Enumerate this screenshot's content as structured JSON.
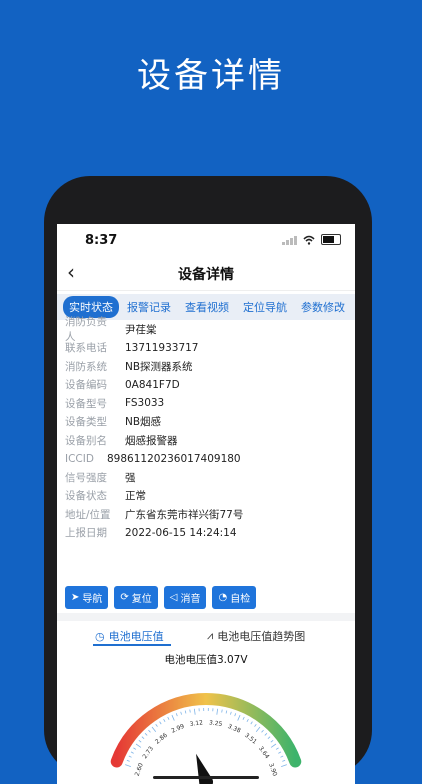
{
  "promo": {
    "title": "设备详情"
  },
  "status_bar": {
    "time": "8:37"
  },
  "nav": {
    "back": "‹",
    "title": "设备详情"
  },
  "tabs": [
    "实时状态",
    "报警记录",
    "查看视频",
    "定位导航",
    "参数修改"
  ],
  "info": [
    {
      "k": "消防负责人",
      "v": "尹荏棠"
    },
    {
      "k": "联系电话",
      "v": "13711933717"
    },
    {
      "k": "消防系统",
      "v": "NB探测器系统"
    },
    {
      "k": "设备编码",
      "v": "0A841F7D"
    },
    {
      "k": "设备型号",
      "v": "FS3033"
    },
    {
      "k": "设备类型",
      "v": "NB烟感"
    },
    {
      "k": "设备别名",
      "v": "烟感报警器"
    },
    {
      "k": "ICCID",
      "v": "89861120236017409180"
    },
    {
      "k": "信号强度",
      "v": "强"
    },
    {
      "k": "设备状态",
      "v": "正常"
    },
    {
      "k": "地址/位置",
      "v": "广东省东莞市祥兴街77号"
    },
    {
      "k": "上报日期",
      "v": "2022-06-15 14:24:14"
    }
  ],
  "actions": [
    {
      "label": "导航",
      "icon": "➤"
    },
    {
      "label": "复位",
      "icon": "⟳"
    },
    {
      "label": "消音",
      "icon": "◁"
    },
    {
      "label": "自检",
      "icon": "◔"
    }
  ],
  "subtabs": [
    {
      "label": "电池电压值",
      "icon": "◷"
    },
    {
      "label": "电池电压值趋势图",
      "icon": "⩘"
    }
  ],
  "gauge": {
    "title": "电池电压值3.07V",
    "min": 2.6,
    "max": 3.9,
    "value": 3.07,
    "ticks": [
      "2.60",
      "2.73",
      "2.86",
      "2.99",
      "3.12",
      "3.25",
      "3.38",
      "3.51",
      "3.64",
      "3.90"
    ],
    "colors": {
      "low": "#e53935",
      "mid": "#f0c24a",
      "high": "#3db36b"
    }
  }
}
